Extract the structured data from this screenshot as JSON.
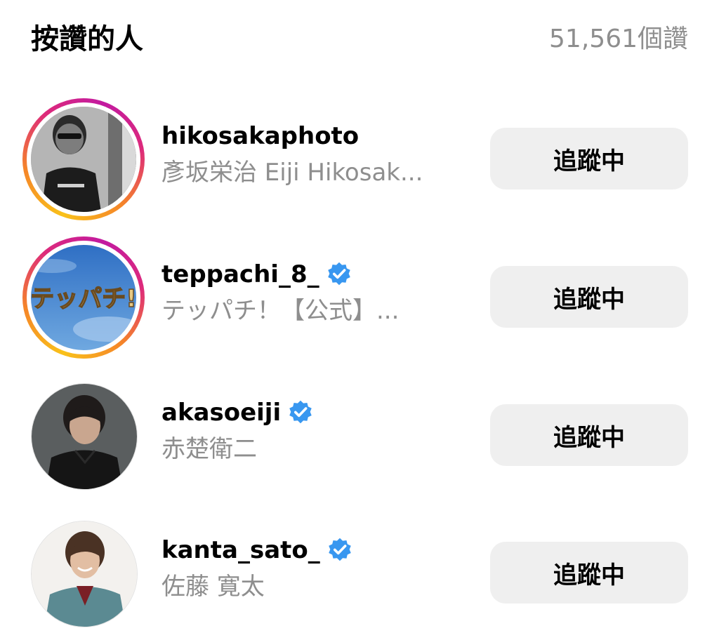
{
  "header": {
    "title": "按讚的人",
    "likes_count": "51,561個讚"
  },
  "users": [
    {
      "username": "hikosakaphoto",
      "full_name": "彥坂栄治 Eiji Hikosak...",
      "verified": false,
      "has_story": true,
      "follow_label": "追蹤中"
    },
    {
      "username": "teppachi_8_",
      "full_name": "テッパチ！【公式】...",
      "verified": true,
      "has_story": true,
      "follow_label": "追蹤中",
      "avatar_text": "テッパチ!"
    },
    {
      "username": "akasoeiji",
      "full_name": "赤楚衛二",
      "verified": true,
      "has_story": false,
      "follow_label": "追蹤中"
    },
    {
      "username": "kanta_sato_",
      "full_name": "佐藤 寛太",
      "verified": true,
      "has_story": false,
      "follow_label": "追蹤中"
    }
  ],
  "colors": {
    "verified_badge": "#3897f0",
    "secondary_text": "#8e8e8e",
    "button_bg": "#efefef"
  }
}
